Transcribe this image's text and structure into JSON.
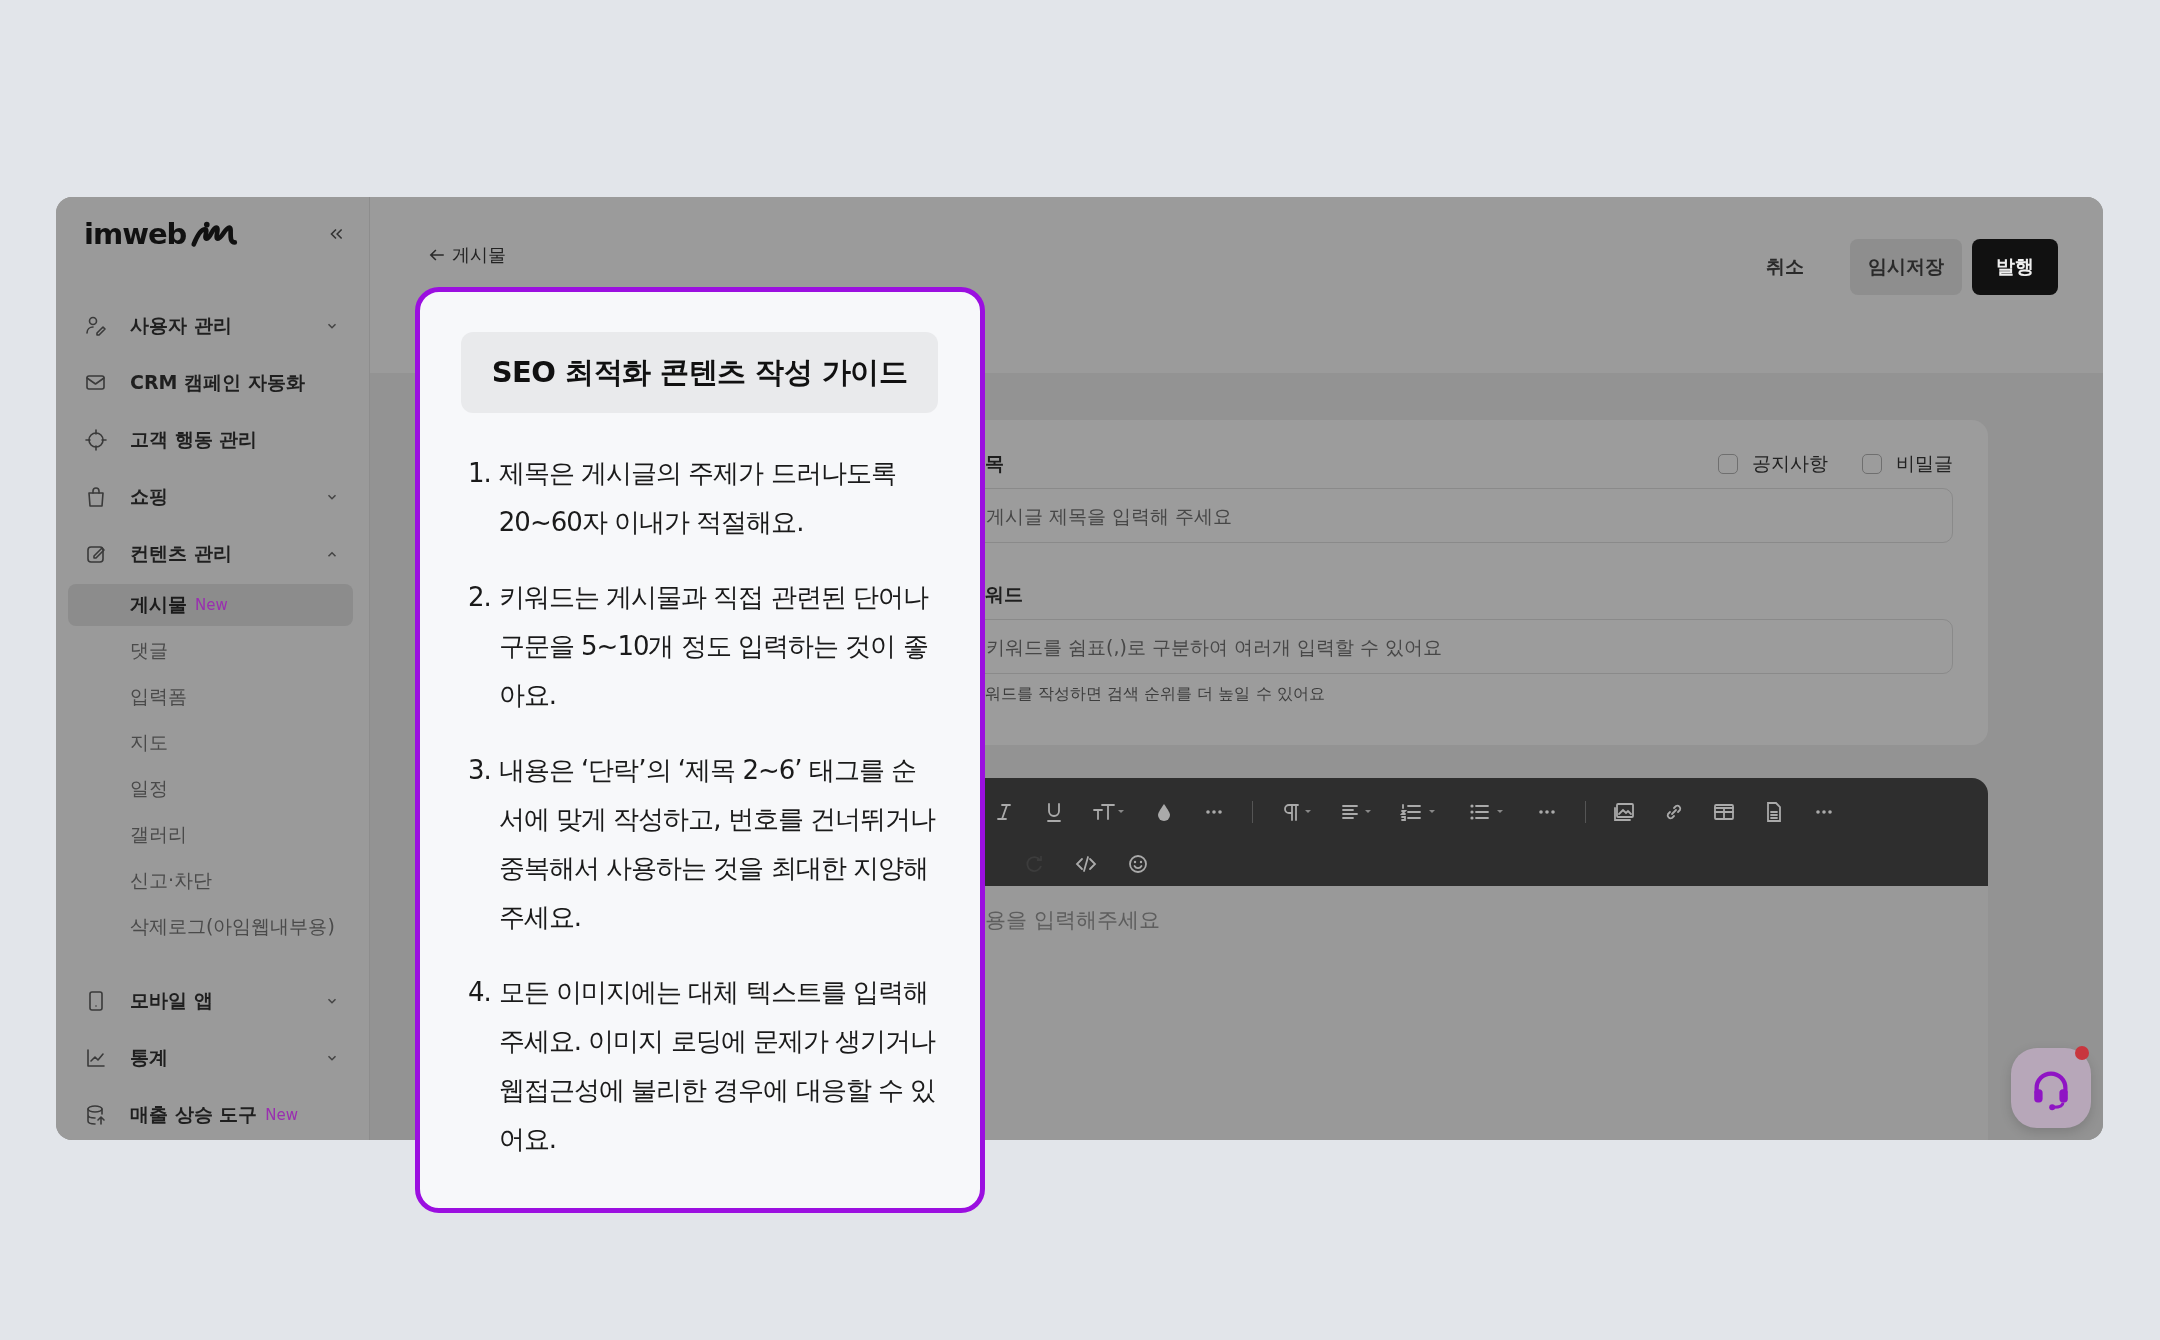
{
  "sidebar": {
    "logo": "imweb",
    "items": [
      {
        "label": "사용자 관리",
        "kind": "menu",
        "expanded": false
      },
      {
        "label": "CRM 캠페인 자동화",
        "kind": "link"
      },
      {
        "label": "고객 행동 관리",
        "kind": "link"
      },
      {
        "label": "쇼핑",
        "kind": "menu",
        "expanded": false
      },
      {
        "label": "컨텐츠 관리",
        "kind": "menu",
        "expanded": true,
        "children": [
          {
            "label": "게시물",
            "badge": "New",
            "selected": true
          },
          {
            "label": "댓글",
            "selected": false
          },
          {
            "label": "입력폼",
            "selected": false
          },
          {
            "label": "지도",
            "selected": false
          },
          {
            "label": "일정",
            "selected": false
          },
          {
            "label": "갤러리",
            "selected": false
          },
          {
            "label": "신고·차단",
            "selected": false
          },
          {
            "label": "삭제로그(아임웹내부용)",
            "selected": false
          }
        ]
      },
      {
        "label": "모바일 앱",
        "kind": "menu",
        "expanded": false
      },
      {
        "label": "통계",
        "kind": "menu",
        "expanded": false
      },
      {
        "label": "매출 상승 도구",
        "kind": "link",
        "badge": "New"
      }
    ]
  },
  "header": {
    "back_link": "게시물",
    "buttons": [
      {
        "label": "취소",
        "kind": "text"
      },
      {
        "label": "임시저장",
        "kind": "secondary"
      },
      {
        "label": "발행",
        "kind": "primary"
      }
    ]
  },
  "form": {
    "title_label": "목",
    "checkboxes": [
      {
        "label": "공지사항",
        "checked": false
      },
      {
        "label": "비밀글",
        "checked": false
      }
    ],
    "title_field": {
      "placeholder": "게시글 제목을 입력해 주세요"
    },
    "keyword_label": "워드",
    "keyword_field": {
      "placeholder": "키워드를 쉼표(,)로 구분하여 여러개 입력할 수 있어요"
    },
    "keyword_help": "워드를 작성하면 검색 순위를 더 높일 수 있어요"
  },
  "editor": {
    "placeholder": "용을 입력해주세요"
  },
  "guide": {
    "title": "SEO 최적화 콘텐츠 작성 가이드",
    "items": [
      {
        "number": "1.",
        "text": "제목은 게시글의 주제가 드러나도록 20~60자 이내가 적절해요."
      },
      {
        "number": "2.",
        "text": "키워드는 게시물과 직접 관련된 단어나 구문을 5~10개 정도 입력하는 것이 좋아요."
      },
      {
        "number": "3.",
        "text": "내용은 ‘단락’의 ‘제목 2~6’ 태그를 순서에 맞게 작성하고, 번호를 건너뛰거나 중복해서 사용하는 것을 최대한 지양해 주세요."
      },
      {
        "number": "4.",
        "text": "모든 이미지에는 대체 텍스트를 입력해 주세요. 이미지 로딩에 문제가 생기거나 웹접근성에 불리한 경우에 대응할 수 있어요."
      }
    ]
  }
}
